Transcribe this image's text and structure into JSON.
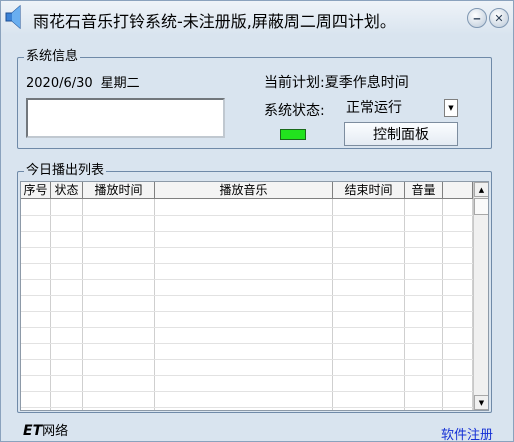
{
  "window": {
    "title": "雨花石音乐打铃系统-未注册版,屏蔽周二周四计划。",
    "minimize_icon": "minimize-icon",
    "close_icon": "close-icon"
  },
  "system_info": {
    "legend": "系统信息",
    "date": "2020/6/30",
    "weekday": "星期二",
    "current_plan_label": "当前计划:",
    "current_plan_value": "夏季作息时间",
    "system_status_label": "系统状态:",
    "system_status_value": "正常运行",
    "control_panel_label": "控制面板",
    "status_led_color": "#22e21e"
  },
  "today_list": {
    "legend": "今日播出列表",
    "columns": [
      "序号",
      "状态",
      "播放时间",
      "播放音乐",
      "结束时间",
      "音量",
      ""
    ],
    "rows": []
  },
  "footer": {
    "logo_mark": "ET",
    "logo_text": "网络",
    "register_link": "软件注册"
  }
}
